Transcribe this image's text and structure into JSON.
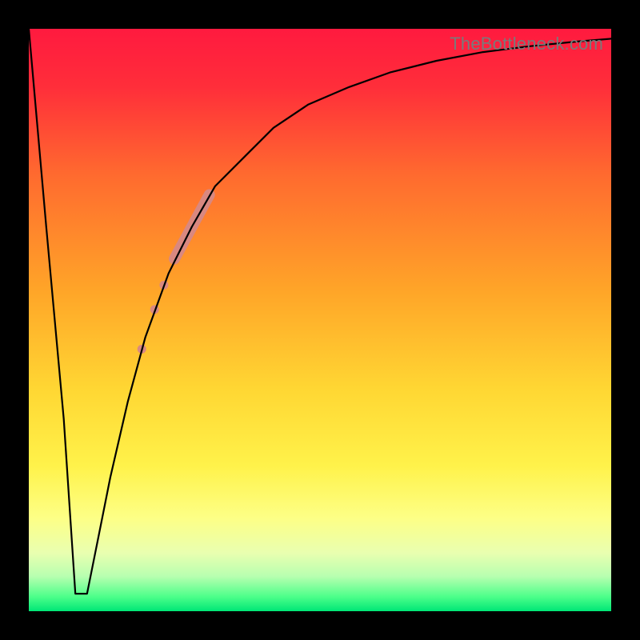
{
  "watermark": "TheBottleneck.com",
  "chart_data": {
    "type": "line",
    "title": "",
    "xlabel": "",
    "ylabel": "",
    "xlim": [
      0,
      100
    ],
    "ylim": [
      0,
      100
    ],
    "grid": false,
    "legend": false,
    "series": [
      {
        "name": "bottleneck-curve",
        "x": [
          0,
          3,
          6,
          8,
          10,
          12,
          14,
          17,
          20,
          24,
          28,
          32,
          37,
          42,
          48,
          55,
          62,
          70,
          78,
          86,
          94,
          100
        ],
        "y": [
          100,
          66,
          33,
          3,
          3,
          13,
          23,
          36,
          47,
          58,
          66,
          73,
          78,
          83,
          87,
          90,
          92.5,
          94.5,
          96,
          97,
          97.8,
          98.3
        ],
        "stroke": "#000000",
        "stroke_width": 2.2
      }
    ],
    "markers": [
      {
        "name": "highlight-segment",
        "shape": "thick-line",
        "color": "#d98880",
        "x": [
          25,
          31
        ],
        "y": [
          60.5,
          71.5
        ],
        "width": 14
      },
      {
        "name": "dot-1",
        "shape": "circle",
        "color": "#d98880",
        "cx": 23.2,
        "cy": 56.0,
        "r": 5.5
      },
      {
        "name": "dot-2",
        "shape": "circle",
        "color": "#d98880",
        "cx": 21.6,
        "cy": 51.8,
        "r": 5.5
      },
      {
        "name": "dot-3",
        "shape": "circle",
        "color": "#d98880",
        "cx": 19.4,
        "cy": 45.0,
        "r": 5.5
      }
    ],
    "background_gradient": {
      "stops": [
        {
          "offset": 0.0,
          "color": "#ff1a3f"
        },
        {
          "offset": 0.1,
          "color": "#ff2e3a"
        },
        {
          "offset": 0.25,
          "color": "#ff6a2f"
        },
        {
          "offset": 0.45,
          "color": "#ffa528"
        },
        {
          "offset": 0.62,
          "color": "#ffd733"
        },
        {
          "offset": 0.75,
          "color": "#fff24a"
        },
        {
          "offset": 0.84,
          "color": "#fdff86"
        },
        {
          "offset": 0.9,
          "color": "#e9ffb0"
        },
        {
          "offset": 0.94,
          "color": "#b8ffb0"
        },
        {
          "offset": 0.975,
          "color": "#4dff8a"
        },
        {
          "offset": 1.0,
          "color": "#00e676"
        }
      ]
    }
  }
}
